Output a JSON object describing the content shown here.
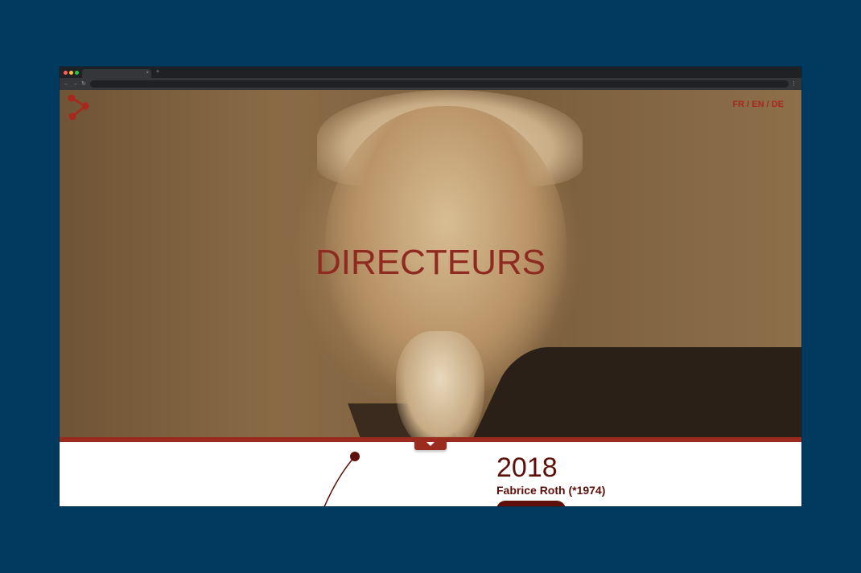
{
  "page": {
    "title": "DIRECTEURS",
    "languages": "FR / EN / DE"
  },
  "browser": {
    "tab_close": "×",
    "new_tab": "+",
    "back": "←",
    "forward": "→",
    "reload": "↻",
    "menu": "⋮"
  },
  "timeline": {
    "entries": [
      {
        "year": "2018",
        "name": "Fabrice Roth (*1974)"
      }
    ]
  },
  "colors": {
    "background": "#013a5f",
    "accent_red": "#9b2a1f",
    "dark_red": "#5e0f0a"
  }
}
